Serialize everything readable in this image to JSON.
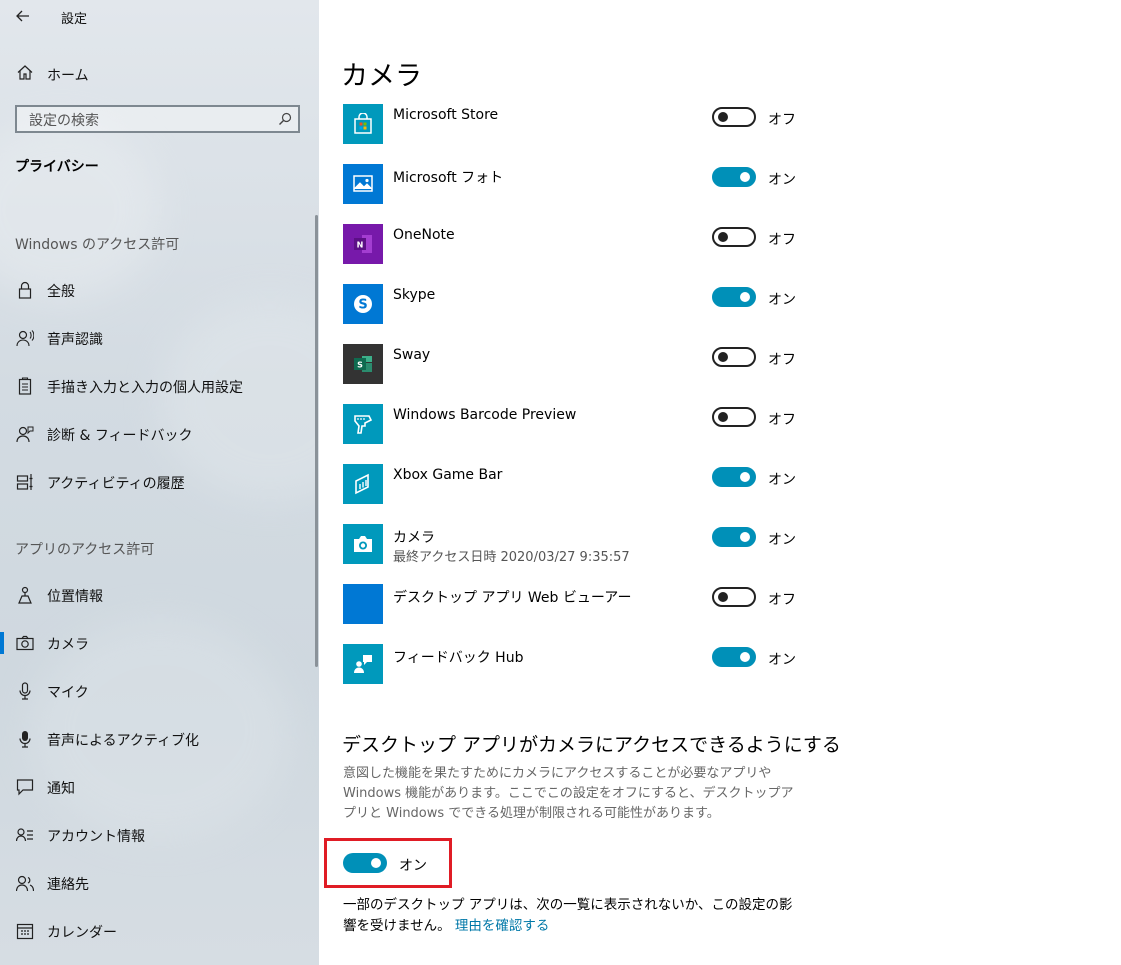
{
  "window": {
    "title": "設定"
  },
  "sidebar": {
    "home_label": "ホーム",
    "search_placeholder": "設定の検索",
    "current_section": "プライバシー",
    "windows_group_heading": "Windows のアクセス許可",
    "windows_items": [
      {
        "label": "全般",
        "icon": "lock-icon"
      },
      {
        "label": "音声認識",
        "icon": "speech-icon"
      },
      {
        "label": "手描き入力と入力の個人用設定",
        "icon": "clipboard-icon"
      },
      {
        "label": "診断 & フィードバック",
        "icon": "feedback-person-icon"
      },
      {
        "label": "アクティビティの履歴",
        "icon": "timeline-icon"
      }
    ],
    "apps_group_heading": "アプリのアクセス許可",
    "apps_items": [
      {
        "label": "位置情報",
        "icon": "location-icon"
      },
      {
        "label": "カメラ",
        "icon": "camera-icon",
        "selected": true
      },
      {
        "label": "マイク",
        "icon": "microphone-icon"
      },
      {
        "label": "音声によるアクティブ化",
        "icon": "voice-activation-icon"
      },
      {
        "label": "通知",
        "icon": "notification-icon"
      },
      {
        "label": "アカウント情報",
        "icon": "account-info-icon"
      },
      {
        "label": "連絡先",
        "icon": "contacts-icon"
      },
      {
        "label": "カレンダー",
        "icon": "calendar-icon"
      }
    ]
  },
  "main": {
    "title": "カメラ",
    "apps": [
      {
        "name": "Microsoft Store",
        "state": "off",
        "state_label": "オフ",
        "tile_color": "#0099bc",
        "icon": "store-icon"
      },
      {
        "name": "Microsoft フォト",
        "state": "on",
        "state_label": "オン",
        "tile_color": "#0078d4",
        "icon": "photos-icon"
      },
      {
        "name": "OneNote",
        "state": "off",
        "state_label": "オフ",
        "tile_color": "#7719aa",
        "icon": "onenote-icon"
      },
      {
        "name": "Skype",
        "state": "on",
        "state_label": "オン",
        "tile_color": "#0078d4",
        "icon": "skype-icon"
      },
      {
        "name": "Sway",
        "state": "off",
        "state_label": "オフ",
        "tile_color": "#333333",
        "icon": "sway-icon"
      },
      {
        "name": "Windows Barcode Preview",
        "state": "off",
        "state_label": "オフ",
        "tile_color": "#0099bc",
        "icon": "barcode-scanner-icon"
      },
      {
        "name": "Xbox Game Bar",
        "state": "on",
        "state_label": "オン",
        "tile_color": "#0099bc",
        "icon": "game-bar-icon"
      },
      {
        "name": "カメラ",
        "subtitle": "最終アクセス日時 2020/03/27 9:35:57",
        "state": "on",
        "state_label": "オン",
        "tile_color": "#0099bc",
        "icon": "camera-app-icon"
      },
      {
        "name": "デスクトップ アプリ Web ビューアー",
        "state": "off",
        "state_label": "オフ",
        "tile_color": "#0078d4",
        "icon": "web-viewer-icon"
      },
      {
        "name": "フィードバック Hub",
        "state": "on",
        "state_label": "オン",
        "tile_color": "#0099bc",
        "icon": "feedback-hub-icon"
      }
    ],
    "desktop_section": {
      "heading": "デスクトップ アプリがカメラにアクセスできるようにする",
      "description": "意図した機能を果たすためにカメラにアクセスすることが必要なアプリや Windows 機能があります。ここでこの設定をオフにすると、デスクトップアプリと Windows でできる処理が制限される可能性があります。",
      "toggle_label": "オン",
      "toggle_state": "on",
      "note": "一部のデスクトップ アプリは、次の一覧に表示されないか、この設定の影響を受けません。",
      "link": "理由を確認する"
    }
  },
  "colors": {
    "accent": "#0090b8",
    "highlight": "#e01c25",
    "link": "#0078a8"
  }
}
